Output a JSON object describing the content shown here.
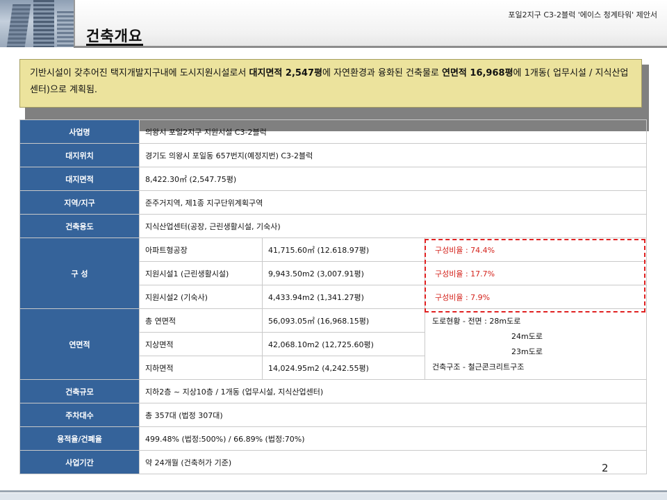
{
  "header": {
    "subtitle": "포일2지구 C3-2블럭 '에이스 청계타워' 제안서",
    "title": "건축개요"
  },
  "summary": {
    "part1": "기반시설이 갖추어진 택지개발지구내에 도시지원시설로서 ",
    "highlight1": "대지면적 2,547평",
    "part2": "에 자연환경과 융화된 건축물로 ",
    "highlight2": "연면적 16,968평",
    "part3": "에 1개동( 업무시설 / 지식산업센터)으로 계획됨."
  },
  "table": {
    "rows": {
      "project": {
        "label": "사업명",
        "value": "의왕시 포일2지구 지원시설 C3-2블럭"
      },
      "location": {
        "label": "대지위치",
        "value": "경기도 의왕시 포일동 657번지(예정지번) C3-2블럭"
      },
      "site_area": {
        "label": "대지면적",
        "value": "8,422.30㎡ (2,547.75평)"
      },
      "zone": {
        "label": "지역/지구",
        "value": "준주거지역, 제1종 지구단위계획구역"
      },
      "use": {
        "label": "건축용도",
        "value": "지식산업센터(공장, 근린생활시설, 기숙사)"
      }
    },
    "composition": {
      "label": "구 성",
      "items": [
        {
          "name": "아파트형공장",
          "area": "41,715.60㎡ (12.618.97평)",
          "ratio": "구성비율 : 74.4%"
        },
        {
          "name": "지원시설1 (근린생활시설)",
          "area": "9,943.50m2 (3,007.91평)",
          "ratio": "구성비율 : 17.7%"
        },
        {
          "name": "지원시설2 (기숙사)",
          "area": "4,433.94m2 (1,341.27평)",
          "ratio": "구성비율 : 7.9%"
        }
      ]
    },
    "floor_area": {
      "label": "연면적",
      "items": [
        {
          "name": "총 연면적",
          "area": "56,093.05㎡ (16,968.15평)"
        },
        {
          "name": "지상면적",
          "area": "42,068.10m2 (12,725.60평)"
        },
        {
          "name": "지하면적",
          "area": "14,024.95m2 (4,242.55평)"
        }
      ],
      "notes": {
        "road1": "도로현황 - 전면 : 28m도로",
        "road2": "24m도로",
        "road3": "23m도로",
        "structure": "건축구조 - 철근콘크리트구조"
      }
    },
    "rows2": {
      "scale": {
        "label": "건축규모",
        "value": "지하2층 ~ 지상10층 / 1개동 (업무시설, 지식산업센터)"
      },
      "parking": {
        "label": "주차대수",
        "value": "총 357대 (법정 307대)"
      },
      "ratio": {
        "label": "용적율/건폐율",
        "value": "499.48% (법정:500%) / 66.89% (법정:70%)"
      },
      "period": {
        "label": "사업기간",
        "value": "약 24개월 (건축허가 기준)"
      }
    }
  },
  "page_number": "2",
  "colors": {
    "header_cell": "#35639a",
    "summary_bg": "#ece39d",
    "ratio_text": "#d4231c"
  }
}
